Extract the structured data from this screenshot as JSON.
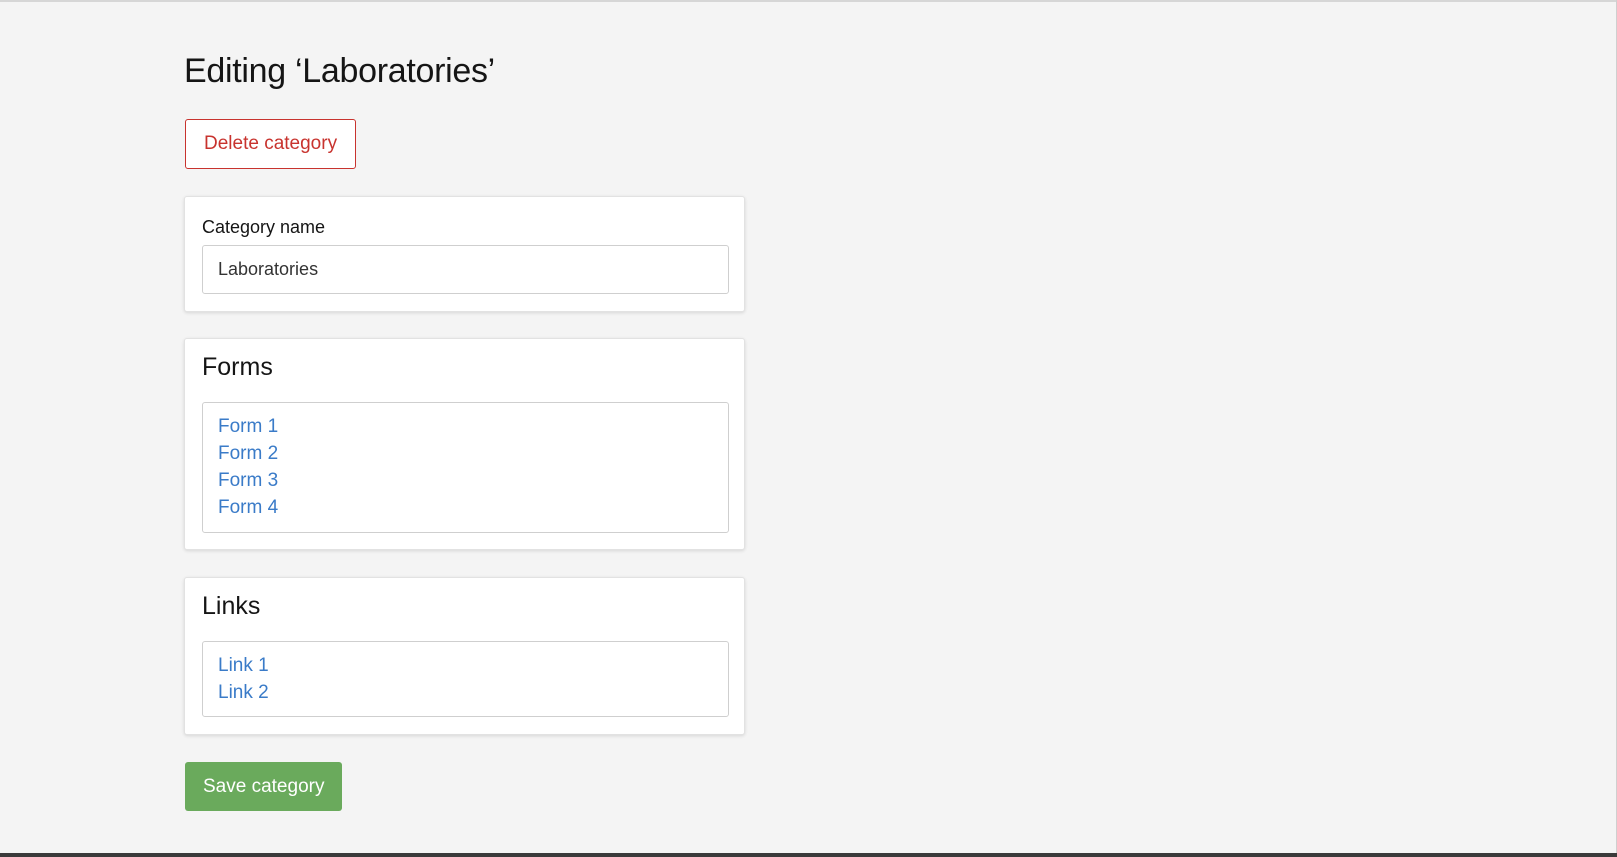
{
  "page": {
    "title": "Editing ‘Laboratories’"
  },
  "actions": {
    "delete_label": "Delete category",
    "save_label": "Save category"
  },
  "name_panel": {
    "label": "Category name",
    "value": "Laboratories"
  },
  "forms_panel": {
    "heading": "Forms",
    "items": [
      "Form 1",
      "Form 2",
      "Form 3",
      "Form 4"
    ]
  },
  "links_panel": {
    "heading": "Links",
    "items": [
      "Link 1",
      "Link 2"
    ]
  },
  "colors": {
    "background": "#f4f4f4",
    "danger": "#c8332e",
    "success": "#6aaa5c",
    "link": "#3a7bc8"
  }
}
